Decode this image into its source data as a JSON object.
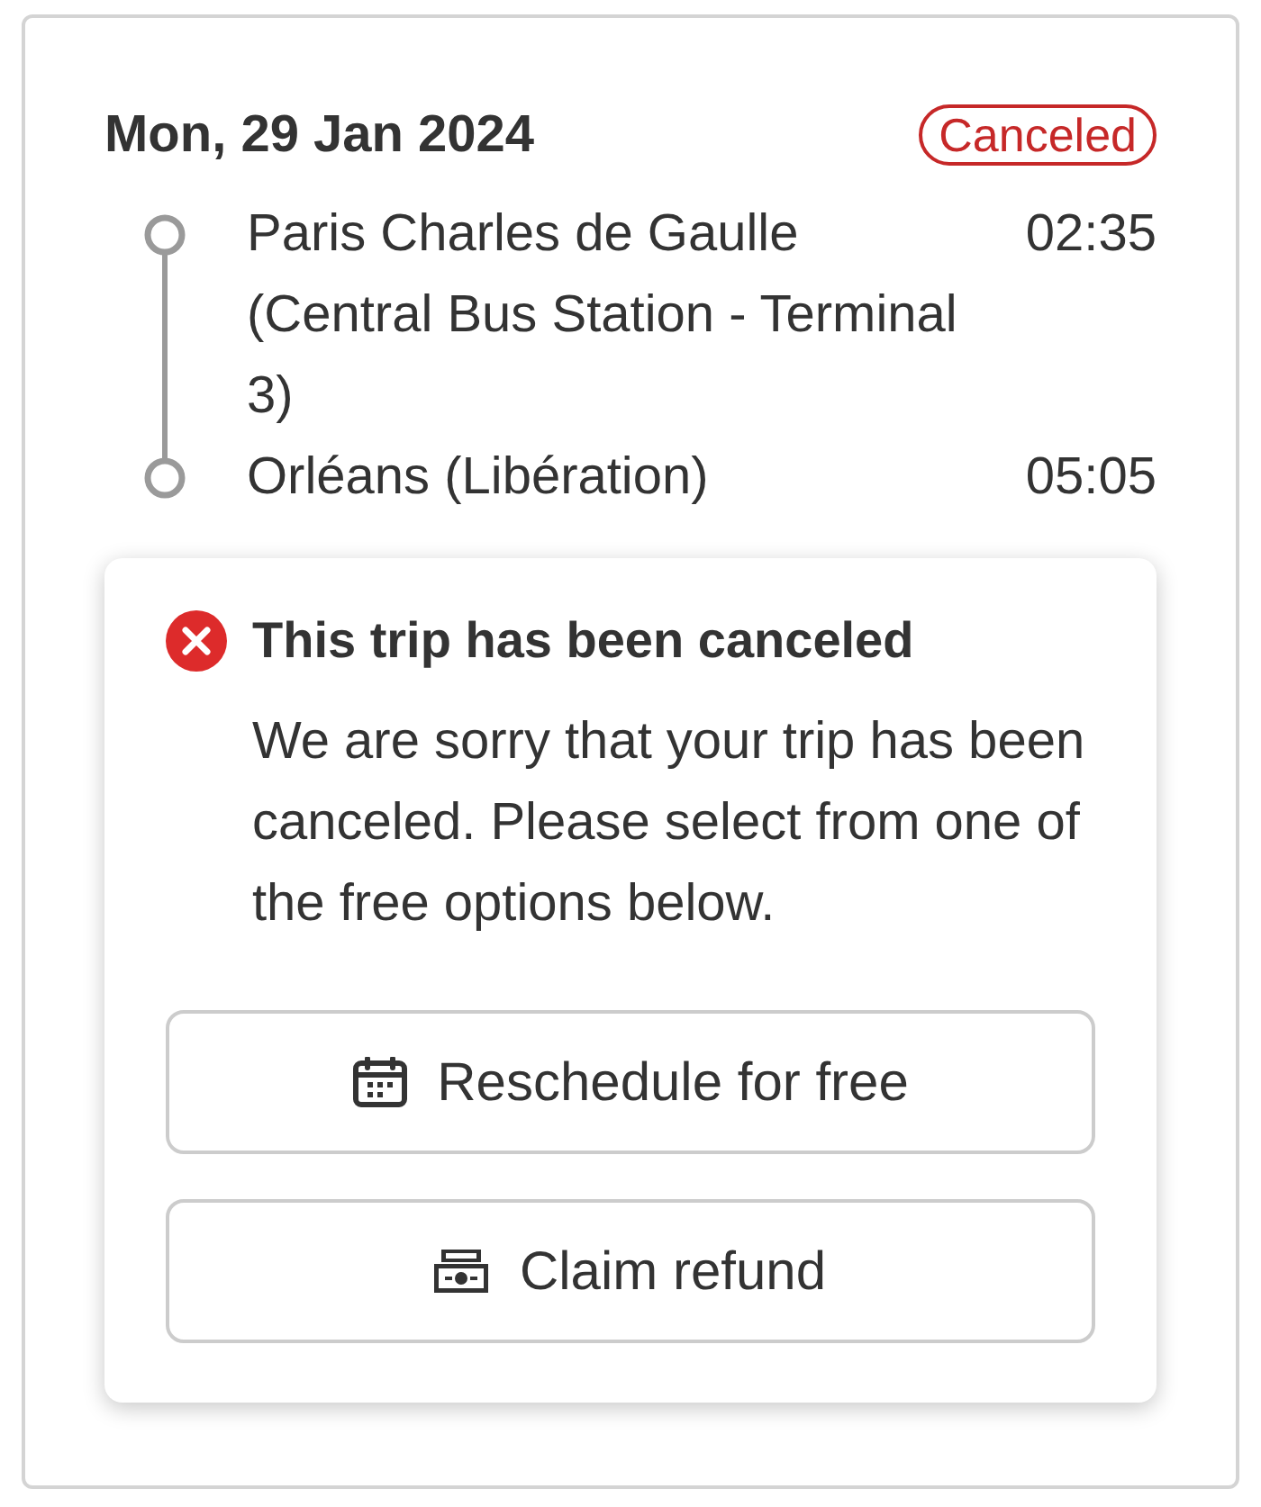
{
  "trip": {
    "date": "Mon, 29 Jan 2024",
    "status": {
      "kind": "canceled",
      "label": "Canceled"
    },
    "stops": [
      {
        "name": "Paris Charles de Gaulle (Central Bus Station - Terminal 3)",
        "time": "02:35"
      },
      {
        "name": "Orléans (Libération)",
        "time": "05:05"
      }
    ]
  },
  "alert": {
    "kind": "error",
    "title": "This trip has been canceled",
    "message": "We are sorry that your trip has been canceled. Please select from one of the free options below."
  },
  "actions": [
    {
      "kind": "reschedule",
      "label": "Reschedule for free"
    },
    {
      "kind": "refund",
      "label": "Claim refund"
    }
  ]
}
